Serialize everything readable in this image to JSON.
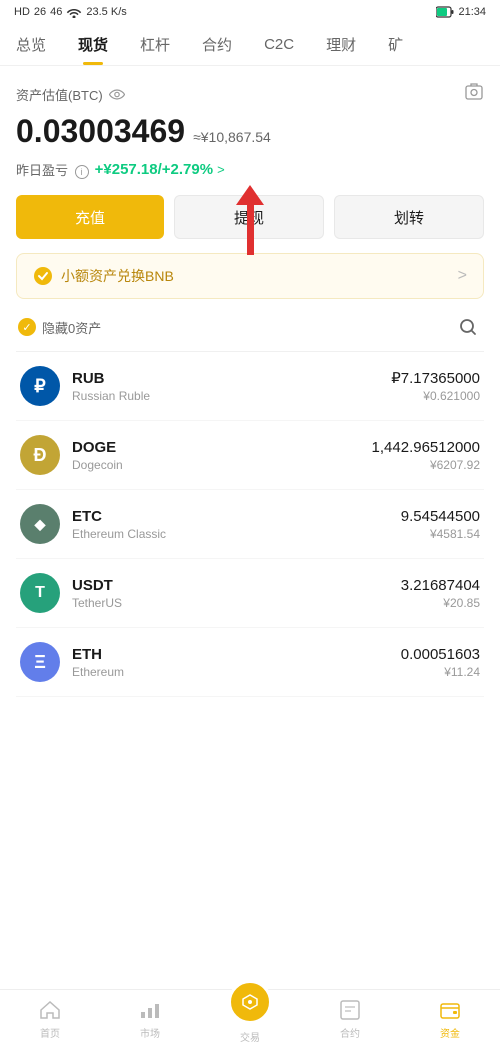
{
  "statusBar": {
    "left": "HD  26  46",
    "speed": "23.5 K/s",
    "time": "21:34"
  },
  "nav": {
    "items": [
      {
        "label": "总览",
        "active": false
      },
      {
        "label": "现货",
        "active": true
      },
      {
        "label": "杠杆",
        "active": false
      },
      {
        "label": "合约",
        "active": false
      },
      {
        "label": "C2C",
        "active": false
      },
      {
        "label": "理财",
        "active": false
      },
      {
        "label": "矿",
        "active": false
      }
    ]
  },
  "asset": {
    "label": "资产估值(BTC)",
    "value": "0.03003469",
    "cny": "≈¥10,867.54",
    "pnlLabel": "昨日盈亏",
    "pnlValue": "+¥257.18/+2.79%",
    "pnlArrow": ">"
  },
  "buttons": {
    "deposit": "充值",
    "withdraw": "提现",
    "transfer": "划转"
  },
  "bnbBanner": {
    "text": "小额资产兑换BNB",
    "arrow": ">"
  },
  "filter": {
    "label": "隐藏0资产",
    "checkmark": "✓"
  },
  "coins": [
    {
      "symbol": "RUB",
      "name": "Russian Ruble",
      "iconText": "₽",
      "iconClass": "coin-rub",
      "amount": "₽7.17365000",
      "cny": "¥0.621000"
    },
    {
      "symbol": "DOGE",
      "name": "Dogecoin",
      "iconText": "Ð",
      "iconClass": "coin-doge",
      "amount": "1,442.96512000",
      "cny": "¥6207.92"
    },
    {
      "symbol": "ETC",
      "name": "Ethereum Classic",
      "iconText": "◆",
      "iconClass": "coin-etc",
      "amount": "9.54544500",
      "cny": "¥4581.54"
    },
    {
      "symbol": "USDT",
      "name": "TetherUS",
      "iconText": "T",
      "iconClass": "coin-usdt",
      "amount": "3.21687404",
      "cny": "¥20.85"
    },
    {
      "symbol": "ETH",
      "name": "Ethereum",
      "iconText": "Ξ",
      "iconClass": "coin-eth",
      "amount": "0.00051603",
      "cny": "¥11.24"
    }
  ],
  "bottomNav": [
    {
      "label": "首页",
      "icon": "⌂",
      "active": false
    },
    {
      "label": "市场",
      "icon": "📊",
      "active": false
    },
    {
      "label": "交易",
      "icon": "🔄",
      "active": false
    },
    {
      "label": "合约",
      "icon": "📋",
      "active": false
    },
    {
      "label": "资金",
      "icon": "💰",
      "active": true
    }
  ]
}
